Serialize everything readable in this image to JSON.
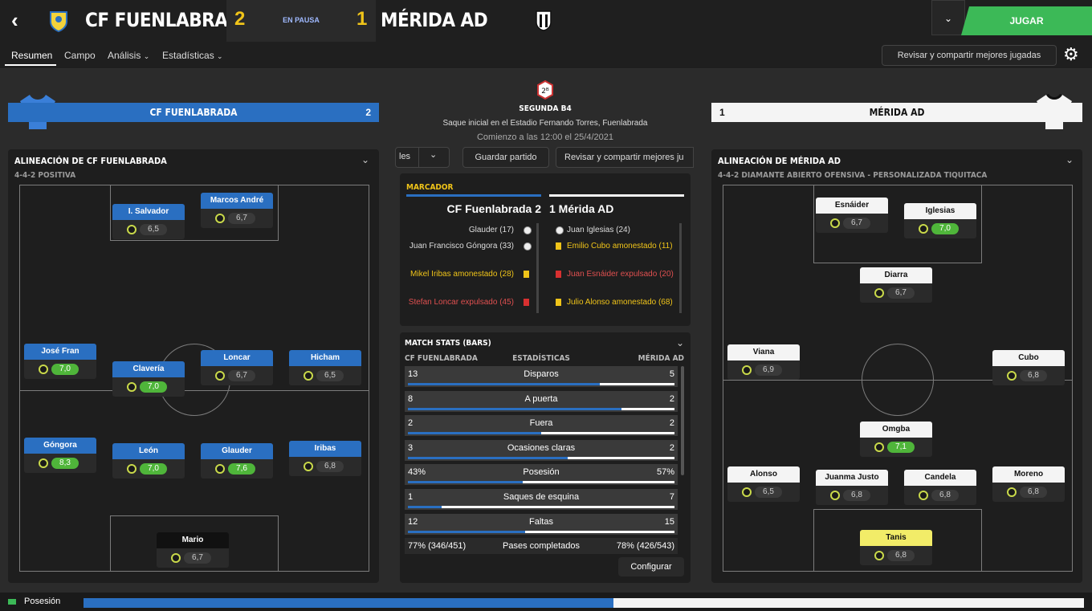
{
  "header": {
    "home_name": "CF FUENLABRADA",
    "home_score": "2",
    "status": "EN PAUSA",
    "away_score": "1",
    "away_name": "MÉRIDA AD",
    "play_label": "JUGAR",
    "colors": {
      "home": "#2a6fc1",
      "away": "#f4f4f4",
      "score": "#f0c419",
      "play": "#3cb957"
    }
  },
  "nav": {
    "tabs": [
      "Resumen",
      "Campo",
      "Análisis",
      "Estadísticas"
    ],
    "share_label": "Revisar y compartir mejores jugadas"
  },
  "center": {
    "competition": "SEGUNDA B4",
    "kickoff_venue": "Saque inicial en el Estadio Fernando Torres, Fuenlabrada",
    "kickoff_time": "Comienzo a las 12:00 el 25/4/2021",
    "partial_btn": "les",
    "save_btn": "Guardar partido",
    "share_btn": "Revisar y compartir mejores ju",
    "scoreboard_title": "MARCADOR",
    "home_line": "CF Fuenlabrada  2",
    "away_line": "1  Mérida AD",
    "home_events": [
      {
        "text": "Glauder (17)",
        "kind": "goal"
      },
      {
        "text": "Juan Francisco Góngora (33)",
        "kind": "goal"
      },
      {
        "text": "Mikel Iribas amonestado (28)",
        "kind": "yellow"
      },
      {
        "text": "Stefan Loncar expulsado (45)",
        "kind": "red"
      }
    ],
    "away_events": [
      {
        "text": "Juan Iglesias (24)",
        "kind": "goal"
      },
      {
        "text": "Emilio Cubo amonestado (11)",
        "kind": "yellow"
      },
      {
        "text": "Juan Esnáider expulsado (20)",
        "kind": "red"
      },
      {
        "text": "Julio Alonso amonestado (68)",
        "kind": "yellow"
      }
    ],
    "stats_title": "MATCH STATS (BARS)",
    "stats_home": "CF FUENLABRADA",
    "stats_mid": "ESTADÍSTICAS",
    "stats_away": "MÉRIDA AD",
    "stats": [
      {
        "label": "Disparos",
        "home": "13",
        "away": "5",
        "hf": 0.72
      },
      {
        "label": "A puerta",
        "home": "8",
        "away": "2",
        "hf": 0.8
      },
      {
        "label": "Fuera",
        "home": "2",
        "away": "2",
        "hf": 0.5
      },
      {
        "label": "Ocasiones claras",
        "home": "3",
        "away": "2",
        "hf": 0.6
      },
      {
        "label": "Posesión",
        "home": "43%",
        "away": "57%",
        "hf": 0.43
      },
      {
        "label": "Saques de esquina",
        "home": "1",
        "away": "7",
        "hf": 0.125
      },
      {
        "label": "Faltas",
        "home": "12",
        "away": "15",
        "hf": 0.44
      }
    ],
    "passes": {
      "label": "Pases completados",
      "home": "77% (346/451)",
      "away": "78% (426/543)"
    },
    "configure_btn": "Configurar"
  },
  "home_panel": {
    "bar_name": "CF FUENLABRADA",
    "bar_score": "2",
    "lineup_title": "ALINEACIÓN DE CF FUENLABRADA",
    "formation": "4-4-2 POSITIVA",
    "players": [
      {
        "name": "I. Salvador",
        "rating": "6,5",
        "good": false
      },
      {
        "name": "Marcos André",
        "rating": "6,7",
        "good": false
      },
      {
        "name": "José Fran",
        "rating": "7,0",
        "good": true
      },
      {
        "name": "Clavería",
        "rating": "7,0",
        "good": true
      },
      {
        "name": "Loncar",
        "rating": "6,7",
        "good": false
      },
      {
        "name": "Hicham",
        "rating": "6,5",
        "good": false
      },
      {
        "name": "Góngora",
        "rating": "8,3",
        "good": true
      },
      {
        "name": "León",
        "rating": "7,0",
        "good": true
      },
      {
        "name": "Glauder",
        "rating": "7,6",
        "good": true
      },
      {
        "name": "Iribas",
        "rating": "6,8",
        "good": false
      },
      {
        "name": "Mario",
        "rating": "6,7",
        "good": false
      }
    ]
  },
  "away_panel": {
    "bar_name": "MÉRIDA AD",
    "bar_score": "1",
    "lineup_title": "ALINEACIÓN DE MÉRIDA AD",
    "formation": "4-4-2 DIAMANTE ABIERTO OFENSIVA - PERSONALIZADA TIQUITACA",
    "players": [
      {
        "name": "Esnáider",
        "rating": "6,7",
        "good": false
      },
      {
        "name": "Iglesias",
        "rating": "7,0",
        "good": true
      },
      {
        "name": "Diarra",
        "rating": "6,7",
        "good": false
      },
      {
        "name": "Viana",
        "rating": "6,9",
        "good": false
      },
      {
        "name": "Cubo",
        "rating": "6,8",
        "good": false
      },
      {
        "name": "Omgba",
        "rating": "7,1",
        "good": true
      },
      {
        "name": "Alonso",
        "rating": "6,5",
        "good": false
      },
      {
        "name": "Juanma Justo",
        "rating": "6,8",
        "good": false
      },
      {
        "name": "Candela",
        "rating": "6,8",
        "good": false
      },
      {
        "name": "Moreno",
        "rating": "6,8",
        "good": false
      },
      {
        "name": "Tanis",
        "rating": "6,8",
        "good": false
      }
    ]
  },
  "footer": {
    "label": "Posesión",
    "home_share": 0.53
  }
}
